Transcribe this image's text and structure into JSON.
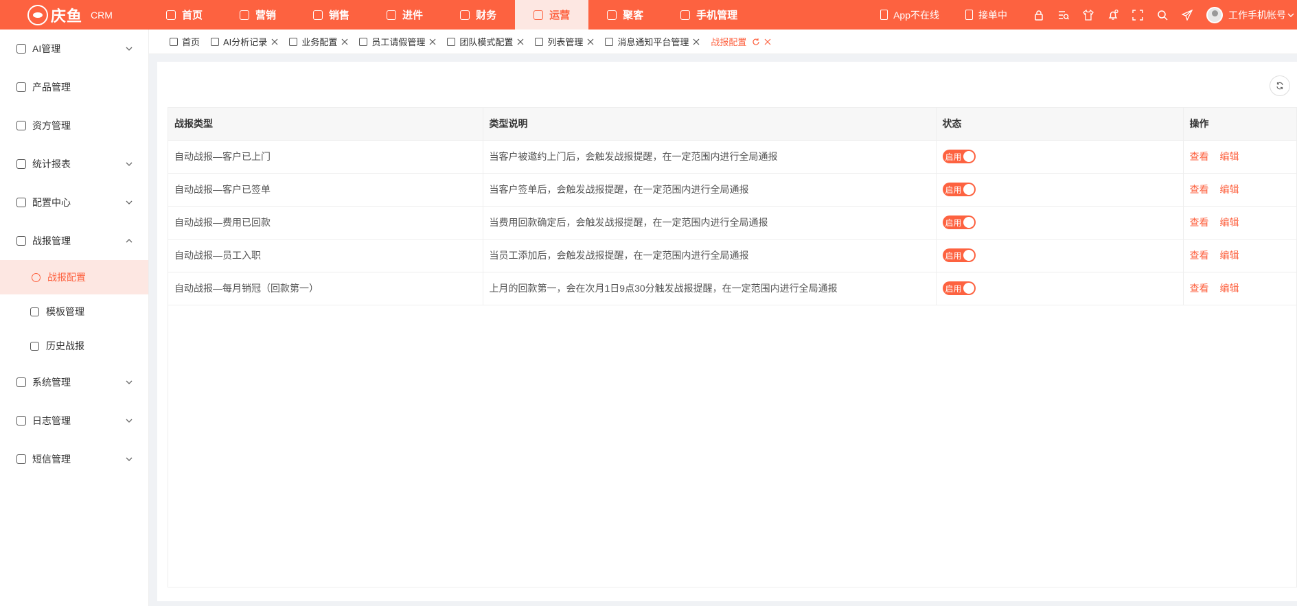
{
  "topbar": {
    "logo_text": "庆鱼",
    "logo_crm": "CRM",
    "nav": [
      {
        "label": "首页",
        "icon": "home-icon"
      },
      {
        "label": "营销",
        "icon": "marketing-icon"
      },
      {
        "label": "销售",
        "icon": "sales-icon"
      },
      {
        "label": "进件",
        "icon": "application-icon"
      },
      {
        "label": "财务",
        "icon": "finance-icon"
      },
      {
        "label": "运营",
        "icon": "operations-icon",
        "active": true
      },
      {
        "label": "聚客",
        "icon": "customers-icon"
      },
      {
        "label": "手机管理",
        "icon": "phone-management-icon"
      }
    ],
    "app_status": "App不在线",
    "order_status": "接单中",
    "user_name": "工作手机帐号"
  },
  "sidebar": {
    "items": [
      {
        "label": "AI管理",
        "icon": "ai-icon",
        "chevron": "down"
      },
      {
        "label": "产品管理",
        "icon": "product-icon"
      },
      {
        "label": "资方管理",
        "icon": "funder-icon"
      },
      {
        "label": "统计报表",
        "icon": "report-icon",
        "chevron": "down"
      },
      {
        "label": "配置中心",
        "icon": "config-icon",
        "chevron": "down"
      },
      {
        "label": "战报管理",
        "icon": "battle-report-icon",
        "chevron": "up"
      }
    ],
    "sub_items": [
      {
        "label": "战报配置",
        "icon": "settings-icon",
        "active": true
      },
      {
        "label": "模板管理",
        "icon": "template-icon"
      },
      {
        "label": "历史战报",
        "icon": "history-icon"
      }
    ],
    "items_after": [
      {
        "label": "系统管理",
        "icon": "system-icon",
        "chevron": "down"
      },
      {
        "label": "日志管理",
        "icon": "log-icon",
        "chevron": "down"
      },
      {
        "label": "短信管理",
        "icon": "sms-icon",
        "chevron": "down"
      }
    ]
  },
  "tabs": [
    {
      "label": "首页",
      "closable": false
    },
    {
      "label": "AI分析记录",
      "closable": true
    },
    {
      "label": "业务配置",
      "closable": true
    },
    {
      "label": "员工请假管理",
      "closable": true
    },
    {
      "label": "团队模式配置",
      "closable": true
    },
    {
      "label": "列表管理",
      "closable": true
    },
    {
      "label": "消息通知平台管理",
      "closable": true
    },
    {
      "label": "战报配置",
      "closable": true,
      "active": true
    }
  ],
  "table": {
    "headers": [
      "战报类型",
      "类型说明",
      "状态",
      "操作"
    ],
    "rows": [
      {
        "type": "自动战报—客户已上门",
        "desc": "当客户被邀约上门后，会触发战报提醒，在一定范围内进行全局通报",
        "status": "启用"
      },
      {
        "type": "自动战报—客户已签单",
        "desc": "当客户签单后，会触发战报提醒，在一定范围内进行全局通报",
        "status": "启用"
      },
      {
        "type": "自动战报—费用已回款",
        "desc": "当费用回款确定后，会触发战报提醒，在一定范围内进行全局通报",
        "status": "启用"
      },
      {
        "type": "自动战报—员工入职",
        "desc": "当员工添加后，会触发战报提醒，在一定范围内进行全局通报",
        "status": "启用"
      },
      {
        "type": "自动战报—每月销冠（回款第一）",
        "desc": "上月的回款第一，会在次月1日9点30分触发战报提醒，在一定范围内进行全局通报",
        "status": "启用"
      }
    ],
    "actions": {
      "view": "查看",
      "edit": "编辑"
    }
  },
  "colors": {
    "accent": "#fd6240",
    "active_bg": "#fde7e2"
  }
}
